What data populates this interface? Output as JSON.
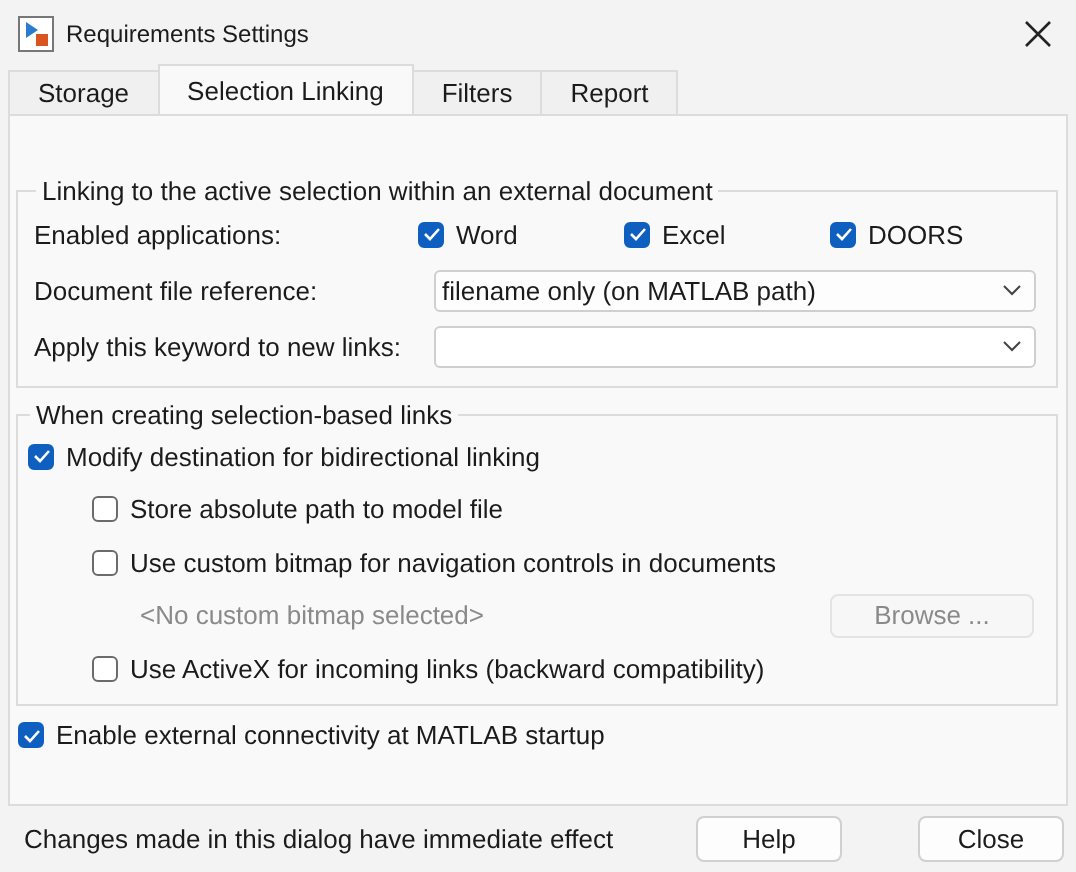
{
  "window": {
    "title": "Requirements Settings"
  },
  "tabs": [
    {
      "label": "Storage",
      "selected": false
    },
    {
      "label": "Selection Linking",
      "selected": true
    },
    {
      "label": "Filters",
      "selected": false
    },
    {
      "label": "Report",
      "selected": false
    }
  ],
  "linking_group": {
    "title": "Linking to the active selection within an external document",
    "applications_label": "Enabled applications:",
    "applications": [
      {
        "label": "Word",
        "checked": true
      },
      {
        "label": "Excel",
        "checked": true
      },
      {
        "label": "DOORS",
        "checked": true
      }
    ],
    "file_reference": {
      "label": "Document file reference:",
      "value": "filename only (on MATLAB path)"
    },
    "keyword": {
      "label": "Apply this keyword to new links:"
    }
  },
  "creation_group": {
    "title": "When creating selection-based links",
    "modify": {
      "label": "Modify destination for bidirectional linking",
      "checked": true
    },
    "options": [
      {
        "kind": "checkbox",
        "label": "Store absolute path to model file",
        "checked": false
      },
      {
        "kind": "checkbox",
        "label": "Use custom bitmap for navigation controls in documents",
        "checked": false
      },
      {
        "kind": "bitmap",
        "text": "<No custom bitmap selected>",
        "button": "Browse ...",
        "disabled": true
      },
      {
        "kind": "checkbox",
        "label": "Use ActiveX for incoming links (backward compatibility)",
        "checked": false
      }
    ]
  },
  "startup": {
    "label": "Enable external connectivity at MATLAB startup",
    "checked": true
  },
  "status_bar": {
    "text": "Changes made in this dialog have immediate effect",
    "buttons": [
      "Help",
      "Close"
    ]
  }
}
